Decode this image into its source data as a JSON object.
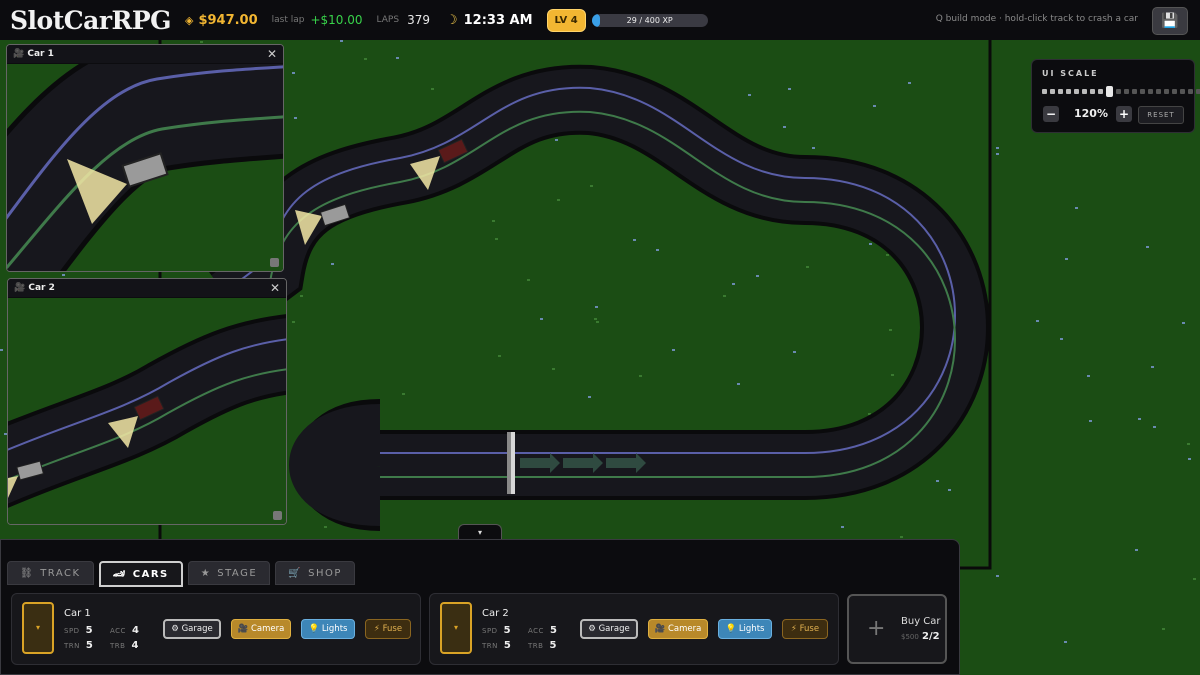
{
  "header": {
    "logo": "SlotCarRPG",
    "money_icon": "◈",
    "money": "$947.00",
    "last_lap_label": "last lap",
    "last_lap_value": "+$10.00",
    "laps_label": "LAPS",
    "laps_value": "379",
    "moon_icon": "☽",
    "clock": "12:33 AM",
    "level": "LV 4",
    "xp_text": "29 / 400 XP",
    "xp_fraction": 0.0725,
    "hint": "Q build mode · hold-click track to crash a car",
    "save_icon": "💾"
  },
  "cameras": [
    {
      "icon": "🎥",
      "title": "Car 1",
      "close": "✕"
    },
    {
      "icon": "🎥",
      "title": "Car 2",
      "close": "✕"
    }
  ],
  "ui_scale": {
    "title": "UI SCALE",
    "value": "120%",
    "minus": "−",
    "plus": "+",
    "reset": "RESET",
    "level_index": 8,
    "steps": 20
  },
  "panel": {
    "collapse": "▾",
    "tabs": [
      {
        "icon": "⛓",
        "label": "TRACK"
      },
      {
        "icon": "🏎",
        "label": "CARS"
      },
      {
        "icon": "★",
        "label": "STAGE"
      },
      {
        "icon": "🛒",
        "label": "SHOP"
      }
    ],
    "cars": [
      {
        "slot": "▾",
        "name": "Car 1",
        "spd_label": "SPD",
        "spd": "5",
        "acc_label": "ACC",
        "acc": "4",
        "trn_label": "TRN",
        "trn": "5",
        "trb_label": "TRB",
        "trb": "4",
        "garage": "⚙ Garage",
        "camera": "🎥 Camera",
        "lights": "💡 Lights",
        "fuse": "⚡ Fuse"
      },
      {
        "slot": "▾",
        "name": "Car 2",
        "spd_label": "SPD",
        "spd": "5",
        "acc_label": "ACC",
        "acc": "5",
        "trn_label": "TRN",
        "trn": "5",
        "trb_label": "TRB",
        "trb": "5",
        "garage": "⚙ Garage",
        "camera": "🎥 Camera",
        "lights": "💡 Lights",
        "fuse": "⚡ Fuse"
      }
    ],
    "buy_car": {
      "plus": "+",
      "label": "Buy Car",
      "price": "$500",
      "count": "2/2"
    }
  },
  "colors": {
    "grass": "#1b4d14",
    "track": "#17171d",
    "lane_blue": "#5a5fa8",
    "lane_green": "#3f7a4a",
    "gold": "#f2b632"
  }
}
